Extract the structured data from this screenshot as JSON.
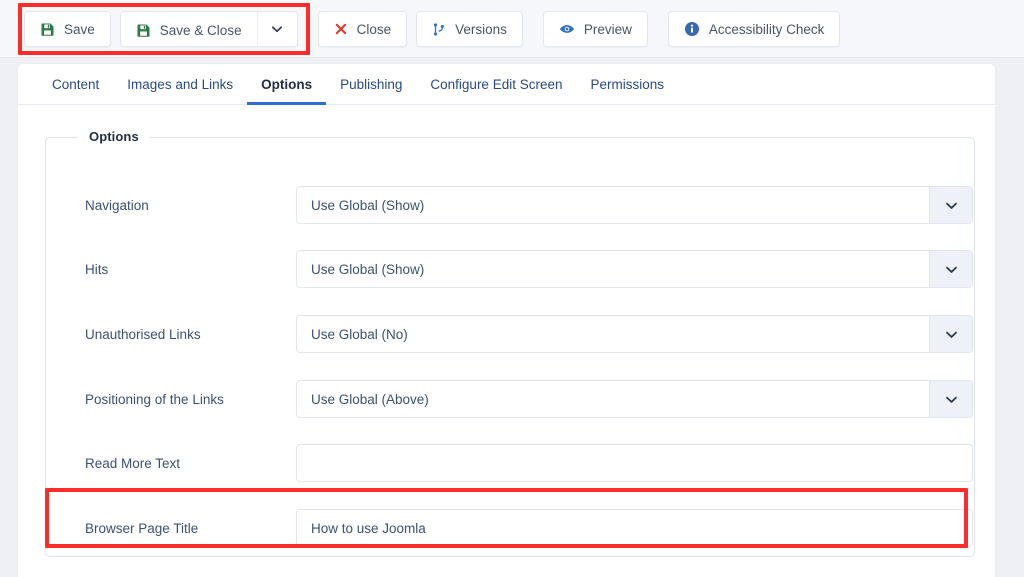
{
  "toolbar": {
    "buttons": [
      {
        "label": "Save",
        "icon": "save-floppy-icon"
      },
      {
        "label": "Save & Close",
        "icon": "save-floppy-icon",
        "has_caret": true,
        "caret_icon": "chevron-down-icon"
      },
      {
        "label": "Close",
        "icon": "close-x-icon"
      },
      {
        "label": "Versions",
        "icon": "code-branch-icon"
      },
      {
        "label": "Preview",
        "icon": "eye-icon"
      },
      {
        "label": "Accessibility Check",
        "icon": "info-circle-icon"
      }
    ]
  },
  "tabs": [
    {
      "label": "Content",
      "active": false
    },
    {
      "label": "Images and Links",
      "active": false
    },
    {
      "label": "Options",
      "active": true
    },
    {
      "label": "Publishing",
      "active": false
    },
    {
      "label": "Configure Edit Screen",
      "active": false
    },
    {
      "label": "Permissions",
      "active": false
    }
  ],
  "fieldset": {
    "legend": "Options",
    "rows": [
      {
        "label": "Navigation",
        "type": "select",
        "value": "Use Global (Show)",
        "arrow": "chevron-down-icon"
      },
      {
        "label": "Hits",
        "type": "select",
        "value": "Use Global (Show)",
        "arrow": "chevron-down-icon"
      },
      {
        "label": "Unauthorised Links",
        "type": "select",
        "value": "Use Global (No)",
        "arrow": "chevron-down-icon"
      },
      {
        "label": "Positioning of the Links",
        "type": "select",
        "value": "Use Global (Above)",
        "arrow": "chevron-down-icon"
      },
      {
        "label": "Read More Text",
        "type": "text",
        "value": "",
        "placeholder": ""
      },
      {
        "label": "Browser Page Title",
        "type": "text",
        "value": "How to use Joomla",
        "placeholder": ""
      }
    ]
  },
  "annotations": {
    "highlight_color": "#fb2c2c",
    "boxes": [
      {
        "name": "save-buttons-highlight"
      },
      {
        "name": "browser-page-title-highlight"
      }
    ]
  },
  "colors": {
    "accent_blue": "#2f6fd0",
    "save_green": "#2c7a47",
    "close_red": "#e8342a",
    "page_bg": "#eef0f6",
    "toolbar_bg": "#f5f7fb"
  }
}
